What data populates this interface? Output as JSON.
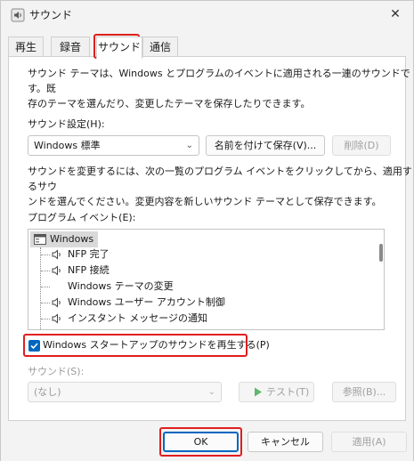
{
  "window": {
    "title": "サウンド",
    "icon": "speaker-icon",
    "close_glyph": "✕"
  },
  "tabs": [
    {
      "label": "再生"
    },
    {
      "label": "録音"
    },
    {
      "label": "サウンド"
    },
    {
      "label": "通信"
    }
  ],
  "description": {
    "line1": "サウンド テーマは、Windows とプログラムのイベントに適用される一連のサウンドです。既",
    "line2": "存のテーマを選んだり、変更したテーマを保存したりできます。"
  },
  "scheme": {
    "label": "サウンド設定(H):",
    "value": "Windows 標準",
    "save_label": "名前を付けて保存(V)...",
    "delete_label": "削除(D)"
  },
  "instructions": {
    "line1": "サウンドを変更するには、次の一覧のプログラム イベントをクリックしてから、適用するサウ",
    "line2": "ンドを選んでください。変更内容を新しいサウンド テーマとして保存できます。"
  },
  "events": {
    "label": "プログラム イベント(E):",
    "root": "Windows",
    "items": [
      {
        "label": "NFP 完了",
        "has_sound": true
      },
      {
        "label": "NFP 接続",
        "has_sound": true
      },
      {
        "label": "Windows テーマの変更",
        "has_sound": false
      },
      {
        "label": "Windows ユーザー アカウント制御",
        "has_sound": true
      },
      {
        "label": "インスタント メッセージの通知",
        "has_sound": true
      }
    ]
  },
  "startup": {
    "label": "Windows スタートアップのサウンドを再生する(P)",
    "checked": true
  },
  "sound": {
    "label": "サウンド(S):",
    "value": "(なし)",
    "test_label": "テスト(T)",
    "browse_label": "参照(B)..."
  },
  "footer": {
    "ok_label": "OK",
    "cancel_label": "キャンセル",
    "apply_label": "適用(A)"
  },
  "colors": {
    "accent": "#0067c0",
    "highlight": "#e01e1e",
    "play_icon": "#2ea043"
  }
}
